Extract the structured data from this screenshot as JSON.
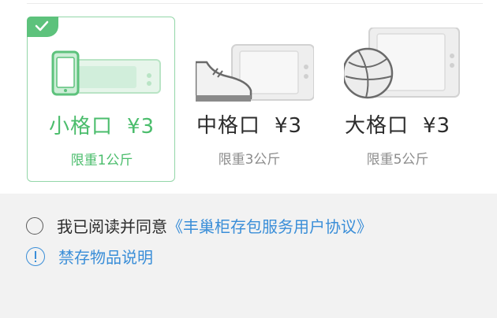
{
  "size_options": [
    {
      "size_label": "小格口",
      "price": "¥3",
      "weight_limit": "限重1公斤",
      "selected": true,
      "icon": "phone-in-locker-icon"
    },
    {
      "size_label": "中格口",
      "price": "¥3",
      "weight_limit": "限重3公斤",
      "selected": false,
      "icon": "shoe-in-locker-icon"
    },
    {
      "size_label": "大格口",
      "price": "¥3",
      "weight_limit": "限重5公斤",
      "selected": false,
      "icon": "basketball-in-locker-icon"
    }
  ],
  "agreement": {
    "text": "我已阅读并同意",
    "link": "《丰巢柜存包服务用户协议》",
    "checked": false
  },
  "prohibited_items": {
    "label": "禁存物品说明"
  },
  "colors": {
    "accent_green": "#4bbd6c",
    "selected_border": "#93d6a8",
    "link_blue": "#3a8ed8",
    "muted_text": "#8c8c8c",
    "background": "#f2f2f2"
  }
}
